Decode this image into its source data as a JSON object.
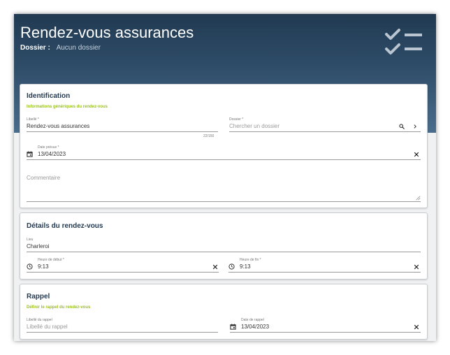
{
  "header": {
    "title": "Rendez-vous assurances",
    "dossier_label": "Dossier :",
    "dossier_value": "Aucun dossier"
  },
  "identification": {
    "title": "Identification",
    "subtitle": "Informations génériques du rendez-vous",
    "libelle_label": "Libellé *",
    "libelle_value": "Rendez-vous assurances",
    "libelle_counter": "22/150",
    "dossier_label": "Dossier *",
    "dossier_placeholder": "Chercher un dossier",
    "date_label": "Date prévue *",
    "date_value": "13/04/2023",
    "commentaire_placeholder": "Commentaire"
  },
  "details": {
    "title": "Détails du rendez-vous",
    "lieu_label": "Lieu",
    "lieu_value": "Charleroi",
    "debut_label": "Heure de début *",
    "debut_value": "9:13",
    "fin_label": "Heure de fin *",
    "fin_value": "9:13"
  },
  "rappel": {
    "title": "Rappel",
    "subtitle": "Définir le rappel du rendez-vous",
    "libelle_label": "Libellé du rappel",
    "libelle_placeholder": "Libellé du rappel",
    "date_label": "Date de rappel",
    "date_value": "13/04/2023"
  },
  "colors": {
    "header_dark": "#213a52",
    "header_light": "#4a6d8c",
    "accent_green": "#9bbf1f",
    "card_title": "#243b53"
  },
  "icons": [
    "checklist-icon",
    "search-icon",
    "chevron-right-icon",
    "calendar-icon",
    "close-icon",
    "clock-icon",
    "resize-handle-icon"
  ]
}
